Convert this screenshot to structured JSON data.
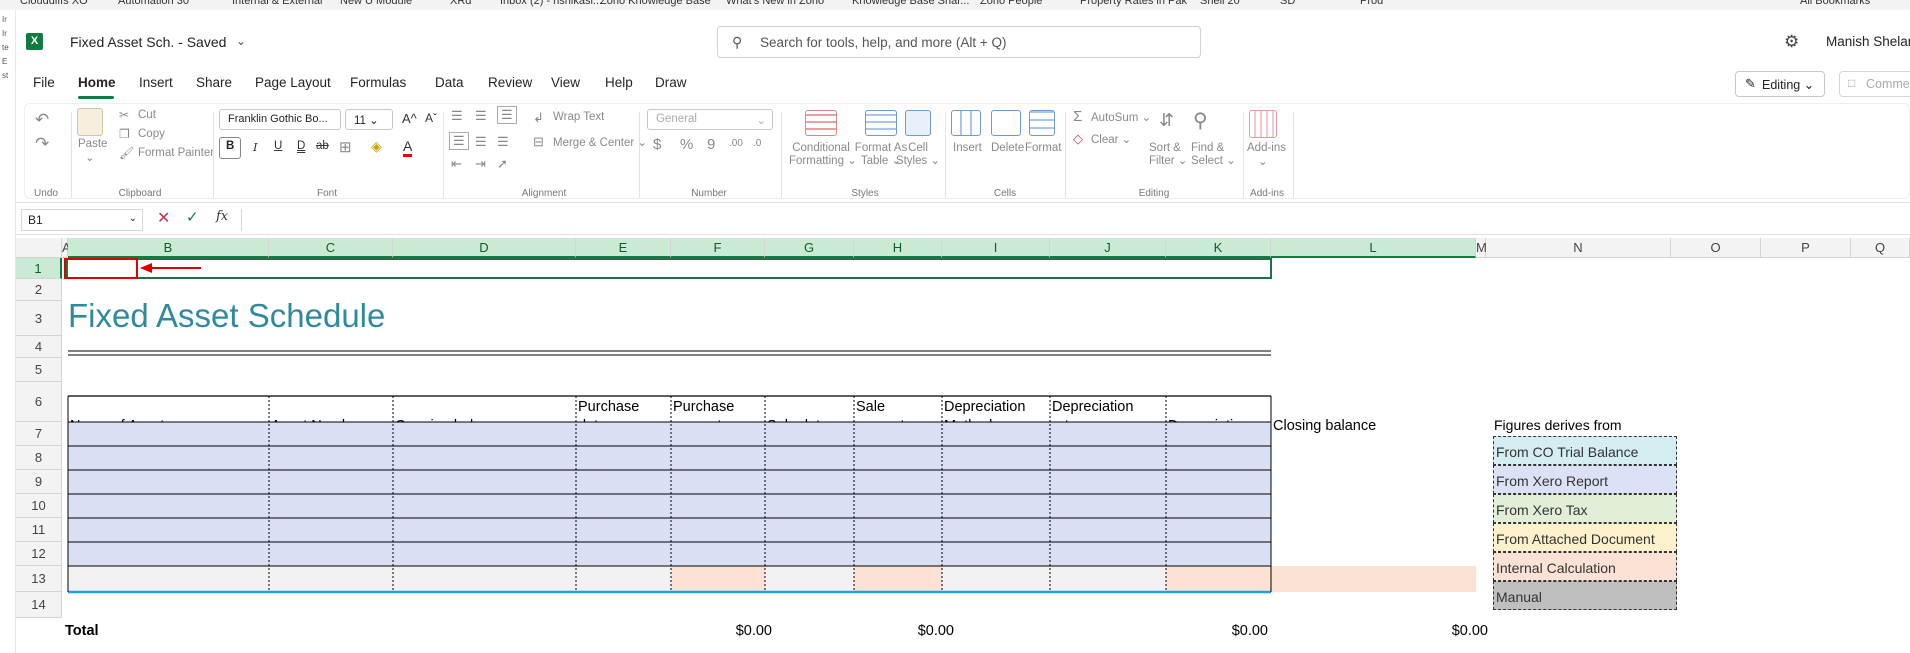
{
  "bookmarks": [
    "Clouddiffs XO",
    "Automation 30",
    "Internal & External",
    "New U Module",
    "XRd",
    "Inbox (2) - rishikasi...",
    "Zoho Knowledge Base",
    "What's New in Zoho",
    "Knowledge Base Shar...",
    "Zoho People",
    "Property Rates in Pak",
    "Shell 20",
    "SD",
    "Prod",
    "All Bookmarks"
  ],
  "left_strip": [
    "Ir",
    "Ir",
    "te",
    "E",
    "st"
  ],
  "app": {
    "logo": "X",
    "doc_title": "Fixed Asset Sch.  -  Saved",
    "search_placeholder": "Search for tools, help, and more (Alt + Q)",
    "user": "Manish Shelar"
  },
  "tabs": [
    {
      "label": "File"
    },
    {
      "label": "Home"
    },
    {
      "label": "Insert"
    },
    {
      "label": "Share"
    },
    {
      "label": "Page Layout"
    },
    {
      "label": "Formulas"
    },
    {
      "label": "Data"
    },
    {
      "label": "Review"
    },
    {
      "label": "View"
    },
    {
      "label": "Help"
    },
    {
      "label": "Draw"
    }
  ],
  "editing_label": "Editing",
  "comments_label": "Comments",
  "ribbon": {
    "undo_group": "Undo",
    "clipboard": {
      "paste": "Paste",
      "cut": "Cut",
      "copy": "Copy",
      "format_painter": "Format Painter",
      "label": "Clipboard"
    },
    "font": {
      "family": "Franklin Gothic Bo...",
      "size": "11",
      "grow": "A^",
      "shrink": "Aˇ",
      "bold": "B",
      "italic": "I",
      "underline": "U",
      "dunderline": "D",
      "strike": "ab",
      "label": "Font"
    },
    "alignment": {
      "wrap": "Wrap Text",
      "merge": "Merge & Center",
      "label": "Alignment"
    },
    "number": {
      "format": "General",
      "currency": "$",
      "percent": "%",
      "comma": "9",
      "inc": ".00",
      "dec": ".0",
      "label": "Number"
    },
    "styles": {
      "conditional": [
        "Conditional",
        "Formatting"
      ],
      "format_as_table": [
        "Format As",
        "Table"
      ],
      "cell_styles": [
        "Cell",
        "Styles"
      ],
      "label": "Styles"
    },
    "cells": {
      "insert": "Insert",
      "delete": "Delete",
      "format": "Format",
      "label": "Cells"
    },
    "editing": {
      "autosum": "AutoSum",
      "clear": "Clear",
      "sort": [
        "Sort &",
        "Filter"
      ],
      "find": [
        "Find &",
        "Select"
      ],
      "label": "Editing"
    },
    "addins": {
      "btn": "Add-ins",
      "label": "Add-ins"
    }
  },
  "formula_bar": {
    "name_box": "B1",
    "cancel": "✕",
    "enter": "✓",
    "fx": "fx",
    "formula": ""
  },
  "columns": [
    "A",
    "B",
    "C",
    "D",
    "E",
    "F",
    "G",
    "H",
    "I",
    "J",
    "K",
    "L",
    "M",
    "N",
    "O",
    "P",
    "Q"
  ],
  "rows": [
    "1",
    "2",
    "3",
    "4",
    "5",
    "6",
    "7",
    "8",
    "9",
    "10",
    "11",
    "12",
    "13",
    "14"
  ],
  "sheet": {
    "title": "Fixed Asset Schedule",
    "headers": [
      "Name of Asset",
      "Asset Number",
      "Opening balance",
      "Purchase\ndate",
      "Purchase\namount",
      "Sale date",
      "Sale\namount",
      "Depreciation\nMethod",
      "Depreciation\nrate",
      "Depreciation",
      "Closing balance"
    ],
    "total_label": "Total",
    "totals": {
      "purchase_amount": "$0.00",
      "sale_amount": "$0.00",
      "depreciation": "$0.00",
      "closing_balance": "$0.00"
    }
  },
  "legend": {
    "title": "Figures derives from",
    "items": [
      {
        "label": "From CO Trial Balance",
        "color": "#d3edf0"
      },
      {
        "label": "From Xero Report",
        "color": "#dce2f5"
      },
      {
        "label": "From Xero Tax",
        "color": "#e1efd9"
      },
      {
        "label": "From Attached Document",
        "color": "#fdf1cc"
      },
      {
        "label": "Internal Calculation",
        "color": "#fbe2d5"
      },
      {
        "label": "Manual",
        "color": "#bfbfbf"
      }
    ]
  },
  "colors": {
    "accent": "#107c41",
    "title": "#2f8b9c",
    "data_fill": "#dae0f3",
    "total_fill": "#fbe2d5",
    "total_row_fill": "#f2f2f2",
    "selection": "#1e7145",
    "annotation": "#e00000"
  }
}
